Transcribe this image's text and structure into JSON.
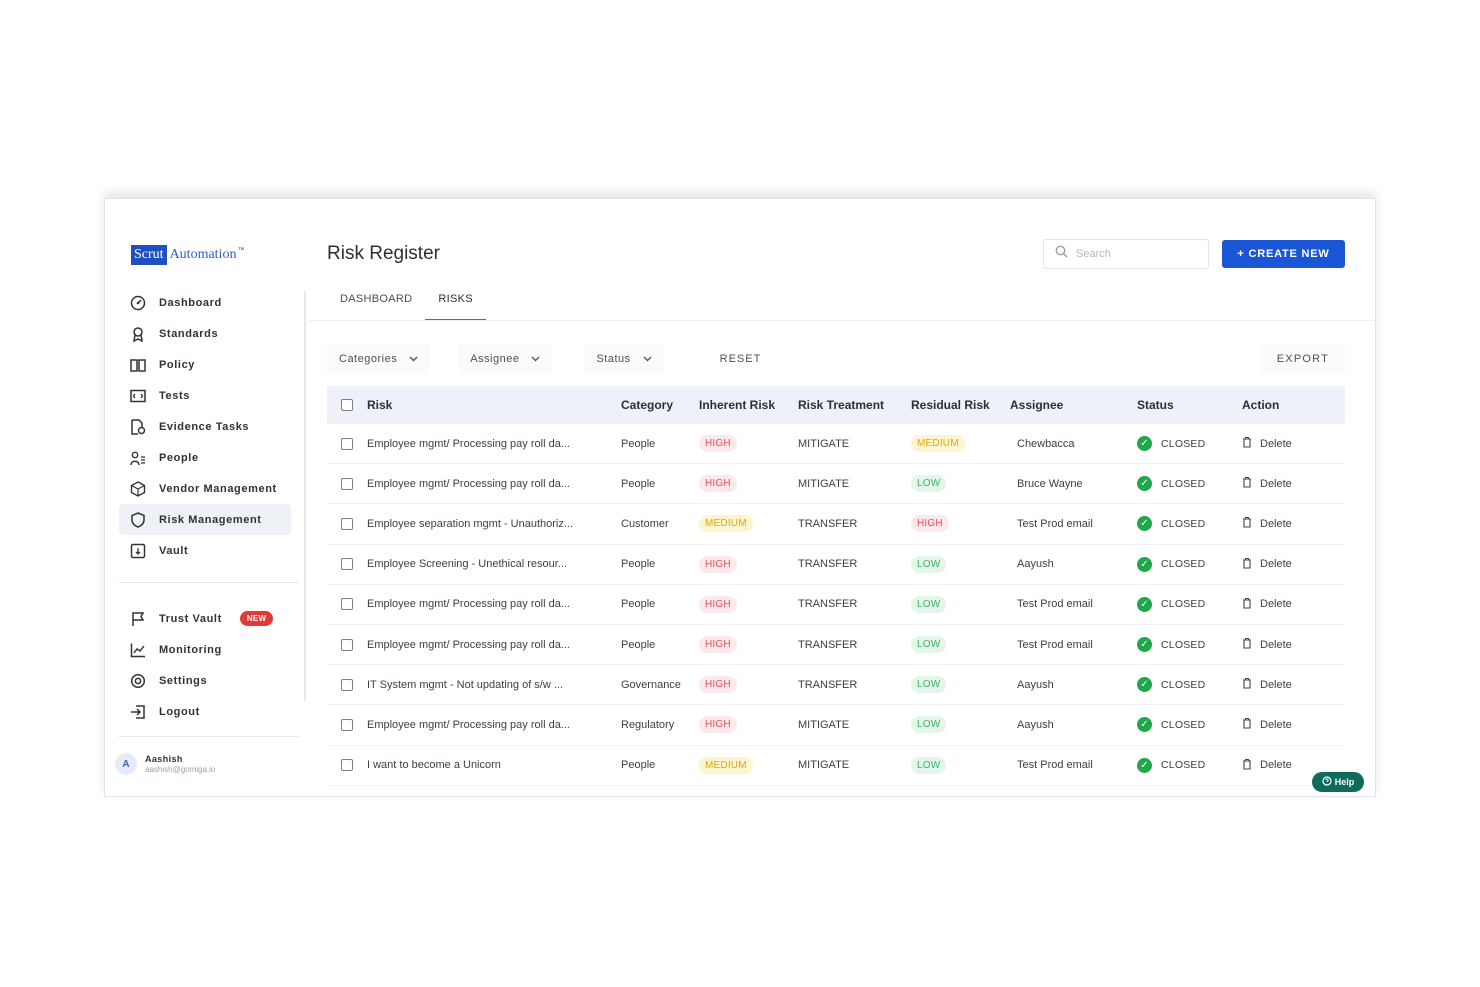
{
  "brand": {
    "box": "Scrut",
    "text": "Automation",
    "tm": "™"
  },
  "nav": [
    {
      "label": "Dashboard",
      "icon": "dashboard-icon"
    },
    {
      "label": "Standards",
      "icon": "standards-icon"
    },
    {
      "label": "Policy",
      "icon": "policy-icon"
    },
    {
      "label": "Tests",
      "icon": "tests-icon"
    },
    {
      "label": "Evidence Tasks",
      "icon": "evidence-tasks-icon"
    },
    {
      "label": "People",
      "icon": "people-icon"
    },
    {
      "label": "Vendor Management",
      "icon": "vendor-icon"
    },
    {
      "label": "Risk Management",
      "icon": "risk-shield-icon",
      "active": true
    },
    {
      "label": "Vault",
      "icon": "vault-icon"
    }
  ],
  "nav2": [
    {
      "label": "Trust Vault",
      "icon": "flag-icon",
      "badge": "NEW"
    },
    {
      "label": "Monitoring",
      "icon": "monitoring-icon"
    },
    {
      "label": "Settings",
      "icon": "settings-icon"
    },
    {
      "label": "Logout",
      "icon": "logout-icon"
    }
  ],
  "user": {
    "initial": "A",
    "name": "Aashish",
    "email": "aashish@gomiga.io"
  },
  "page": {
    "title": "Risk Register"
  },
  "search": {
    "placeholder": "Search"
  },
  "create_button": "+ CREATE NEW",
  "tabs": [
    {
      "label": "DASHBOARD"
    },
    {
      "label": "RISKS",
      "active": true
    }
  ],
  "filters": {
    "categories": "Categories",
    "assignee": "Assignee",
    "status": "Status",
    "reset": "RESET",
    "export": "EXPORT"
  },
  "table": {
    "headers": {
      "risk": "Risk",
      "category": "Category",
      "inherent": "Inherent Risk",
      "treatment": "Risk Treatment",
      "residual": "Residual Risk",
      "assignee": "Assignee",
      "status": "Status",
      "action": "Action"
    },
    "rows": [
      {
        "risk": "Employee mgmt/ Processing pay roll da...",
        "category": "People",
        "inherent": "HIGH",
        "treatment": "MITIGATE",
        "residual": "MEDIUM",
        "assignee": "Chewbacca",
        "status": "CLOSED",
        "action": "Delete"
      },
      {
        "risk": "Employee mgmt/ Processing pay roll da...",
        "category": "People",
        "inherent": "HIGH",
        "treatment": "MITIGATE",
        "residual": "LOW",
        "assignee": "Bruce Wayne",
        "status": "CLOSED",
        "action": "Delete"
      },
      {
        "risk": "Employee separation mgmt - Unauthoriz...",
        "category": "Customer",
        "inherent": "MEDIUM",
        "treatment": "TRANSFER",
        "residual": "HIGH",
        "assignee": "Test Prod email",
        "status": "CLOSED",
        "action": "Delete"
      },
      {
        "risk": "Employee Screening - Unethical resour...",
        "category": "People",
        "inherent": "HIGH",
        "treatment": "TRANSFER",
        "residual": "LOW",
        "assignee": "Aayush",
        "status": "CLOSED",
        "action": "Delete"
      },
      {
        "risk": "Employee mgmt/ Processing pay roll da...",
        "category": "People",
        "inherent": "HIGH",
        "treatment": "TRANSFER",
        "residual": "LOW",
        "assignee": "Test Prod email",
        "status": "CLOSED",
        "action": "Delete"
      },
      {
        "risk": "Employee mgmt/ Processing pay roll da...",
        "category": "People",
        "inherent": "HIGH",
        "treatment": "TRANSFER",
        "residual": "LOW",
        "assignee": "Test Prod email",
        "status": "CLOSED",
        "action": "Delete"
      },
      {
        "risk": "IT System mgmt - Not updating of s/w ...",
        "category": "Governance",
        "inherent": "HIGH",
        "treatment": "TRANSFER",
        "residual": "LOW",
        "assignee": "Aayush",
        "status": "CLOSED",
        "action": "Delete"
      },
      {
        "risk": "Employee mgmt/ Processing pay roll da...",
        "category": "Regulatory",
        "inherent": "HIGH",
        "treatment": "MITIGATE",
        "residual": "LOW",
        "assignee": "Aayush",
        "status": "CLOSED",
        "action": "Delete"
      },
      {
        "risk": "I want to become a Unicorn",
        "category": "People",
        "inherent": "MEDIUM",
        "treatment": "MITIGATE",
        "residual": "LOW",
        "assignee": "Test Prod email",
        "status": "CLOSED",
        "action": "Delete"
      }
    ]
  },
  "help": "Help",
  "colors": {
    "primary": "#1a56d6",
    "high": "#e0505e",
    "medium": "#d6a915",
    "low": "#3db36b",
    "closed": "#1ea84a",
    "help": "#0f6b5c",
    "new_badge": "#e53935"
  }
}
